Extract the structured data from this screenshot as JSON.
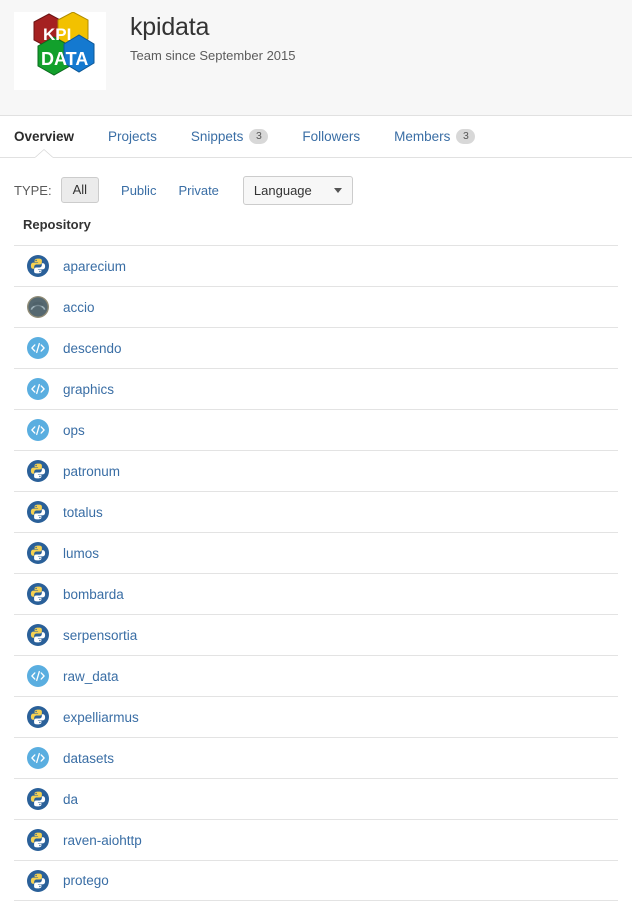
{
  "group": {
    "title": "kpidata",
    "subtitle": "Team since September 2015",
    "avatar_icon": "kpi-data-hex-logo",
    "avatar_text_top": "KPI",
    "avatar_text_bottom": "DATA",
    "avatar_colors": {
      "top_left": "#a52121",
      "top_right": "#f2c100",
      "bottom_left": "#12a02c",
      "bottom_right": "#1479d0"
    }
  },
  "tabs": [
    {
      "label": "Overview",
      "active": true,
      "badge": ""
    },
    {
      "label": "Projects",
      "active": false,
      "badge": ""
    },
    {
      "label": "Snippets",
      "active": false,
      "badge": "3"
    },
    {
      "label": "Followers",
      "active": false,
      "badge": ""
    },
    {
      "label": "Members",
      "active": false,
      "badge": "3"
    }
  ],
  "filters": {
    "type_label": "TYPE:",
    "all_label": "All",
    "public_label": "Public",
    "private_label": "Private",
    "language_label": "Language",
    "caret_icon": "chevron-down-icon"
  },
  "repositories": {
    "column_header": "Repository",
    "items": [
      {
        "name": "aparecium",
        "icon": "python-icon"
      },
      {
        "name": "accio",
        "icon": "sphere-icon"
      },
      {
        "name": "descendo",
        "icon": "code-icon"
      },
      {
        "name": "graphics",
        "icon": "code-icon"
      },
      {
        "name": "ops",
        "icon": "code-icon"
      },
      {
        "name": "patronum",
        "icon": "python-icon"
      },
      {
        "name": "totalus",
        "icon": "python-icon"
      },
      {
        "name": "lumos",
        "icon": "python-icon"
      },
      {
        "name": "bombarda",
        "icon": "python-icon"
      },
      {
        "name": "serpensortia",
        "icon": "python-icon"
      },
      {
        "name": "raw_data",
        "icon": "code-icon"
      },
      {
        "name": "expelliarmus",
        "icon": "python-icon"
      },
      {
        "name": "datasets",
        "icon": "code-icon"
      },
      {
        "name": "da",
        "icon": "python-icon"
      },
      {
        "name": "raven-aiohttp",
        "icon": "python-icon"
      },
      {
        "name": "protego",
        "icon": "python-icon"
      }
    ]
  },
  "colors": {
    "link": "#3a6ea5",
    "header_bg": "#f7f7f7",
    "divider": "#e3e3e3",
    "badge_bg": "#d8d8d8",
    "python_icon_bg": "#2a6099",
    "code_icon_bg": "#5aaee0",
    "sphere_icon_bg": "#5a6b72"
  }
}
